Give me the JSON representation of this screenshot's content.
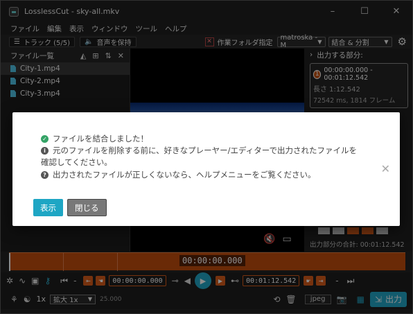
{
  "window": {
    "title": "LosslessCut - sky-all.mkv",
    "controls": [
      "–",
      "☐",
      "✕"
    ]
  },
  "menu": [
    "ファイル",
    "編集",
    "表示",
    "ウィンドウ",
    "ツール",
    "ヘルプ"
  ],
  "toolbar": {
    "tracks_label": "トラック (5/5)",
    "audio_label": "音声を保持",
    "workfolder_label": "作業フォルダ指定",
    "format_value": "matroska - M",
    "mode_value": "結合 & 分割"
  },
  "filelist": {
    "header": "ファイル一覧",
    "files": [
      "City-1.mp4",
      "City-2.mp4",
      "City-3.mp4"
    ]
  },
  "segments": {
    "header": "出力する部分:",
    "items": [
      {
        "num": "1",
        "range": "00:00:00.000 - 00:01:12.542",
        "length": "長さ 1:12.542",
        "detail": "72542 ms, 1814 フレーム"
      }
    ],
    "total_label": "出力部分の合計:",
    "total_value": "00:01:12.542"
  },
  "timeline": {
    "current_time": "00:00:00.000"
  },
  "controls": {
    "start_time": "00:00:00.000",
    "end_time": "00:01:12.542"
  },
  "bottom": {
    "speed": "1x",
    "zoom": "拡大 1x",
    "fps": "25.000",
    "capture_format": "jpeg",
    "export_label": "出力"
  },
  "dialog": {
    "line1": "ファイルを結合しました！",
    "line2a": "元のファイルを削除する前に、好きなプレーヤー/エディターで出力されたファイルを",
    "line2b": "確認してください。",
    "line3": "出力されたファイルが正しくないなら、ヘルプメニューをご覧ください。",
    "show_label": "表示",
    "close_label": "閉じる"
  }
}
